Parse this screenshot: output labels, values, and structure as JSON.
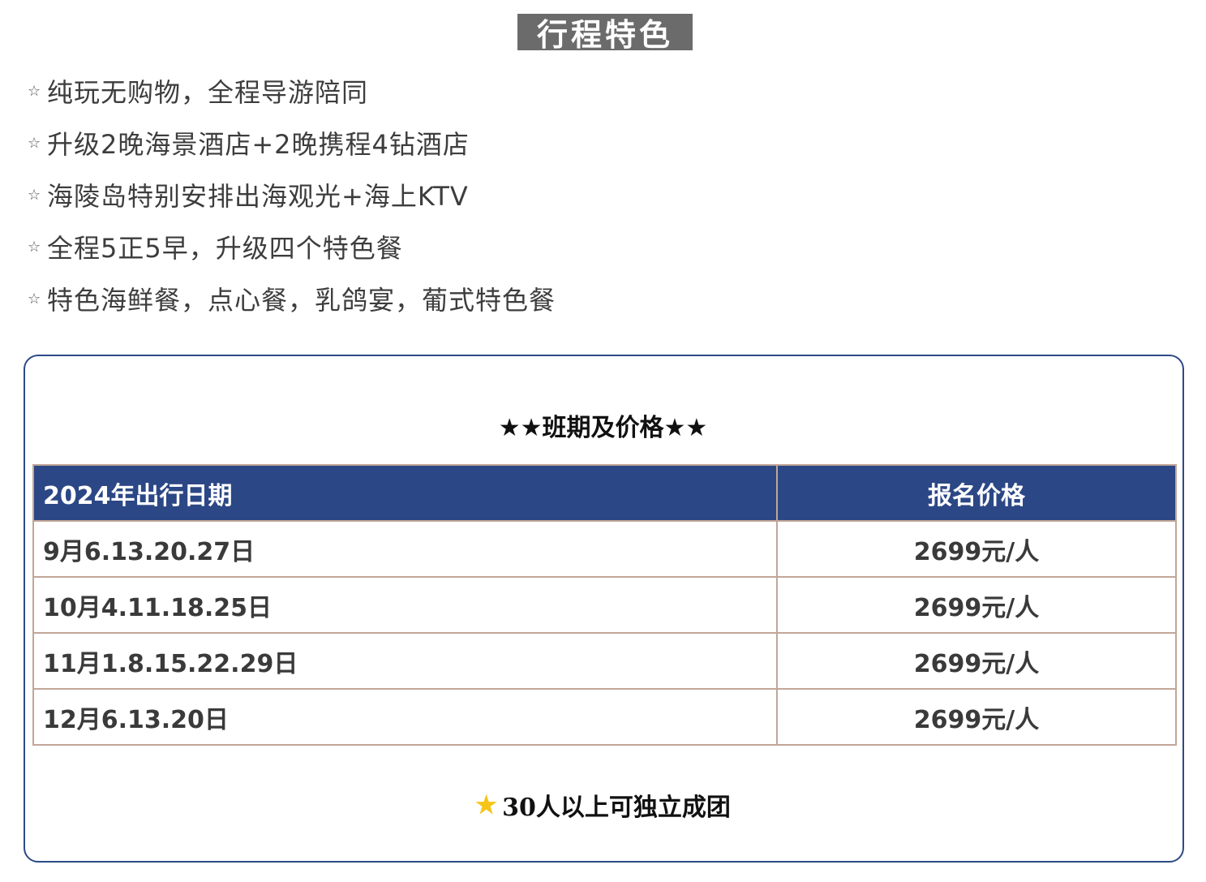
{
  "features_section": {
    "title": "行程特色",
    "star_glyph": "☆",
    "items": [
      {
        "text": "纯玩无购物，全程导游陪同"
      },
      {
        "text": "升级2晚海景酒店+2晚携程4钻酒店"
      },
      {
        "text": "海陵岛特别安排出海观光+海上KTV"
      },
      {
        "text": "全程5正5早，升级四个特色餐"
      },
      {
        "text": "特色海鲜餐，点心餐，乳鸽宴，葡式特色餐"
      }
    ]
  },
  "price_panel": {
    "title": "★★班期及价格★★",
    "table": {
      "headers": {
        "date": "2024年出行日期",
        "price": "报名价格"
      },
      "rows": [
        {
          "date": "9月6.13.20.27日",
          "price": "2699元/人"
        },
        {
          "date": "10月4.11.18.25日",
          "price": "2699元/人"
        },
        {
          "date": "11月1.8.15.22.29日",
          "price": "2699元/人"
        },
        {
          "date": "12月6.13.20日",
          "price": "2699元/人"
        }
      ]
    },
    "footnote": {
      "icon": "star-icon",
      "text": "30人以上可独立成团"
    }
  },
  "colors": {
    "title_badge_bg": "#6b6b6b",
    "panel_border": "#2c4a86",
    "table_header_bg": "#2c4785",
    "table_border": "#c2a698",
    "footnote_star": "#f5c518"
  }
}
